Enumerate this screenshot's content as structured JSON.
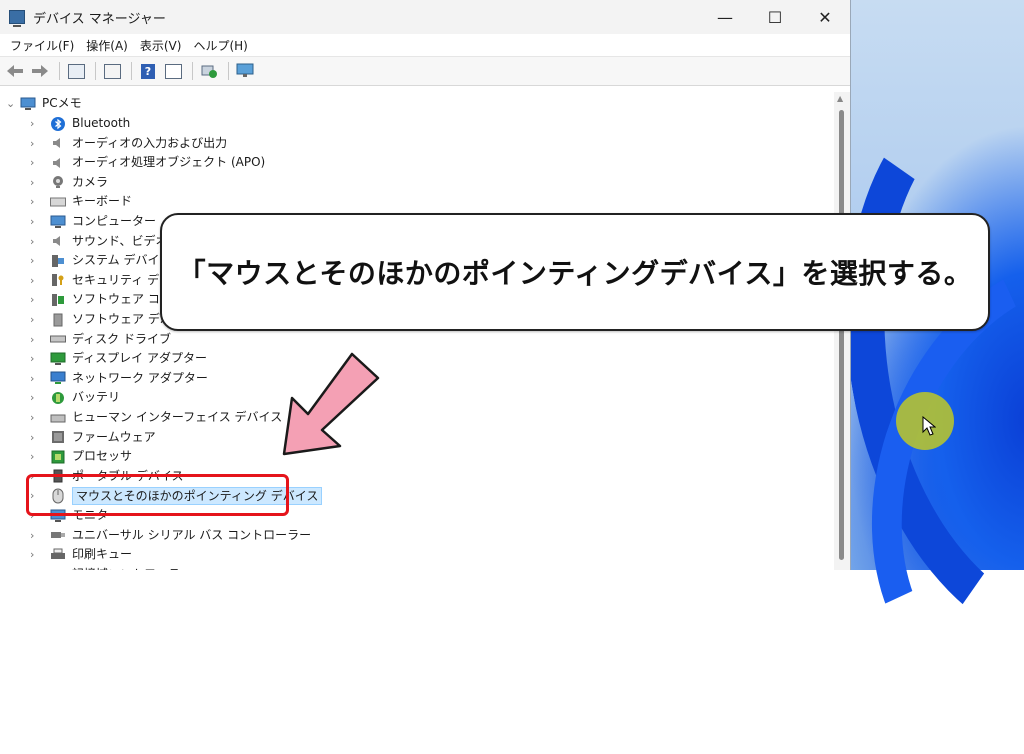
{
  "window": {
    "title": "デバイス マネージャー",
    "controls": {
      "minimize": "—",
      "maximize": "☐",
      "close": "✕"
    }
  },
  "menu": [
    "ファイル(F)",
    "操作(A)",
    "表示(V)",
    "ヘルプ(H)"
  ],
  "toolbar": {
    "icons": [
      "back-icon",
      "forward-icon",
      "show-hide-tree-icon",
      "properties-icon",
      "help-icon",
      "view-icon",
      "update-driver-icon",
      "scan-hardware-icon"
    ],
    "help_glyph": "?"
  },
  "tree": {
    "root": "PCメモ",
    "items": [
      {
        "label": "Bluetooth",
        "icon": "bluetooth-icon"
      },
      {
        "label": "オーディオの入力および出力",
        "icon": "speaker-icon"
      },
      {
        "label": "オーディオ処理オブジェクト (APO)",
        "icon": "speaker-icon"
      },
      {
        "label": "カメラ",
        "icon": "camera-icon"
      },
      {
        "label": "キーボード",
        "icon": "keyboard-icon"
      },
      {
        "label": "コンピューター",
        "icon": "computer-icon"
      },
      {
        "label": "サウンド、ビデオ、お",
        "icon": "sound-icon"
      },
      {
        "label": "システム デバイス",
        "icon": "system-icon"
      },
      {
        "label": "セキュリティ デバイス",
        "icon": "security-icon"
      },
      {
        "label": "ソフトウェア コンポー",
        "icon": "software-icon"
      },
      {
        "label": "ソフトウェア デバイス",
        "icon": "software-device-icon"
      },
      {
        "label": "ディスク ドライブ",
        "icon": "disk-icon"
      },
      {
        "label": "ディスプレイ アダプター",
        "icon": "display-icon"
      },
      {
        "label": "ネットワーク アダプター",
        "icon": "network-icon"
      },
      {
        "label": "バッテリ",
        "icon": "battery-icon"
      },
      {
        "label": "ヒューマン インターフェイス デバイス",
        "icon": "hid-icon"
      },
      {
        "label": "ファームウェア",
        "icon": "firmware-icon"
      },
      {
        "label": "プロセッサ",
        "icon": "processor-icon"
      },
      {
        "label": "ポータブル デバイス",
        "icon": "portable-icon"
      },
      {
        "label": "マウスとそのほかのポインティング デバイス",
        "icon": "mouse-icon",
        "selected": true
      },
      {
        "label": "モニター",
        "icon": "monitor-icon"
      },
      {
        "label": "ユニバーサル シリアル バス コントローラー",
        "icon": "usb-icon"
      },
      {
        "label": "印刷キュー",
        "icon": "printer-icon"
      },
      {
        "label": "記憶域コントローラー",
        "icon": "storage-icon"
      }
    ]
  },
  "callout": {
    "text": "「マウスとそのほかのポインティングデバイス」を選択する。"
  },
  "colors": {
    "highlight_border": "#e5141b",
    "arrow_fill": "#f4a0b4",
    "selection_bg": "#cce8ff",
    "cursor_halo": "#cdd214"
  }
}
